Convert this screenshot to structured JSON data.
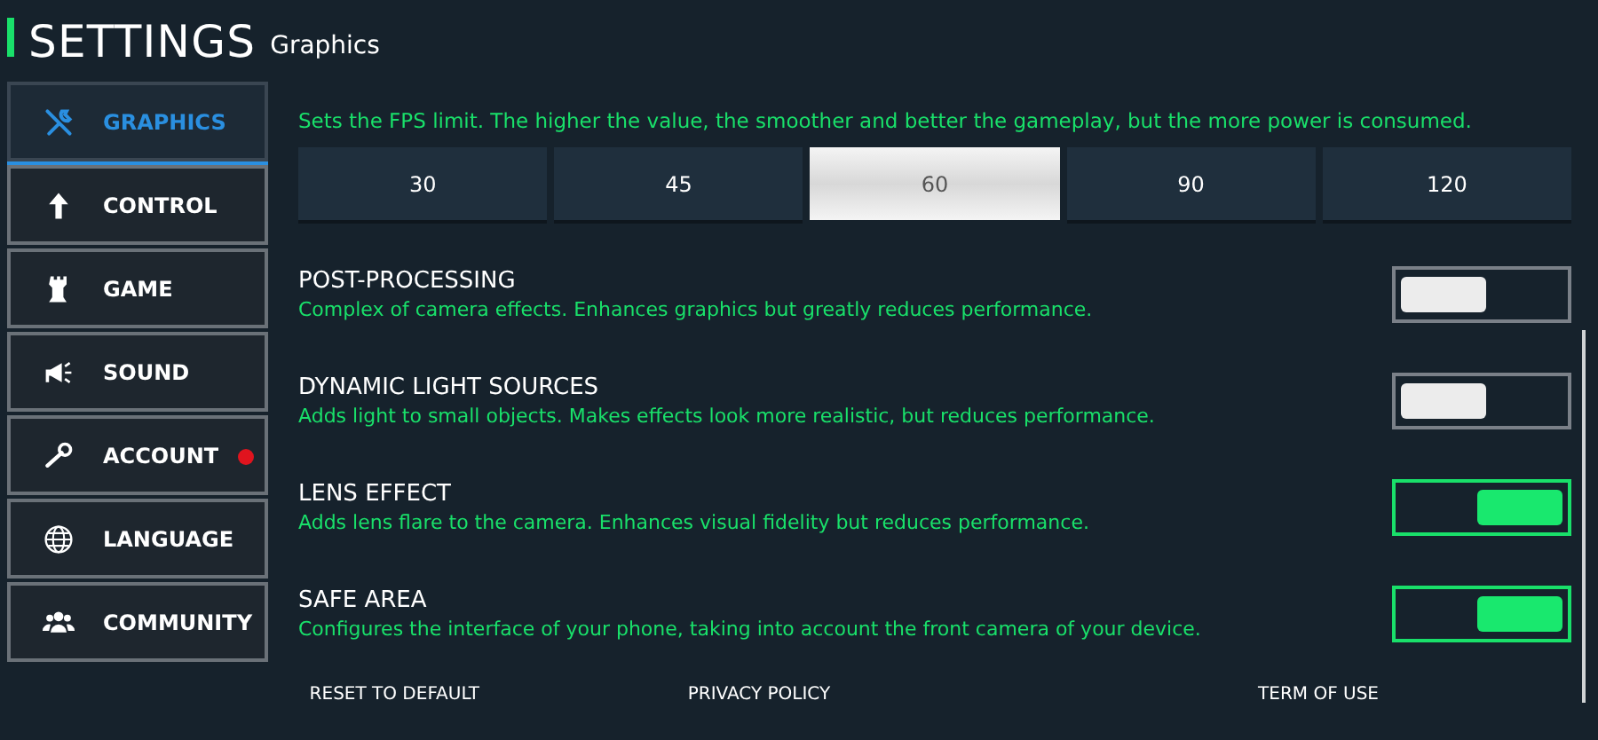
{
  "header": {
    "title": "SETTINGS",
    "subtitle": "Graphics"
  },
  "nav": [
    {
      "label": "GRAPHICS",
      "selected": true,
      "notification": false
    },
    {
      "label": "CONTROL",
      "selected": false,
      "notification": false
    },
    {
      "label": "GAME",
      "selected": false,
      "notification": false
    },
    {
      "label": "SOUND",
      "selected": false,
      "notification": false
    },
    {
      "label": "ACCOUNT",
      "selected": false,
      "notification": true
    },
    {
      "label": "LANGUAGE",
      "selected": false,
      "notification": false
    },
    {
      "label": "COMMUNITY",
      "selected": false,
      "notification": false
    }
  ],
  "fps": {
    "description": "Sets the FPS limit. The higher the value, the smoother and better the gameplay, but the more power is consumed.",
    "options": [
      {
        "label": "30",
        "selected": false
      },
      {
        "label": "45",
        "selected": false
      },
      {
        "label": "60",
        "selected": true
      },
      {
        "label": "90",
        "selected": false
      },
      {
        "label": "120",
        "selected": false
      }
    ]
  },
  "settings": [
    {
      "title": "POST-PROCESSING",
      "description": "Complex of camera effects. Enhances graphics but greatly reduces performance.",
      "on": false
    },
    {
      "title": "DYNAMIC LIGHT SOURCES",
      "description": "Adds light to small objects. Makes effects look more realistic, but reduces performance.",
      "on": false
    },
    {
      "title": "LENS EFFECT",
      "description": "Adds lens flare to the camera. Enhances visual fidelity but reduces performance.",
      "on": true
    },
    {
      "title": "SAFE AREA",
      "description": "Configures the interface of your phone, taking into account the front camera of your device.",
      "on": true
    }
  ],
  "footer": [
    "RESET TO DEFAULT",
    "PRIVACY POLICY",
    "TERM OF USE"
  ]
}
